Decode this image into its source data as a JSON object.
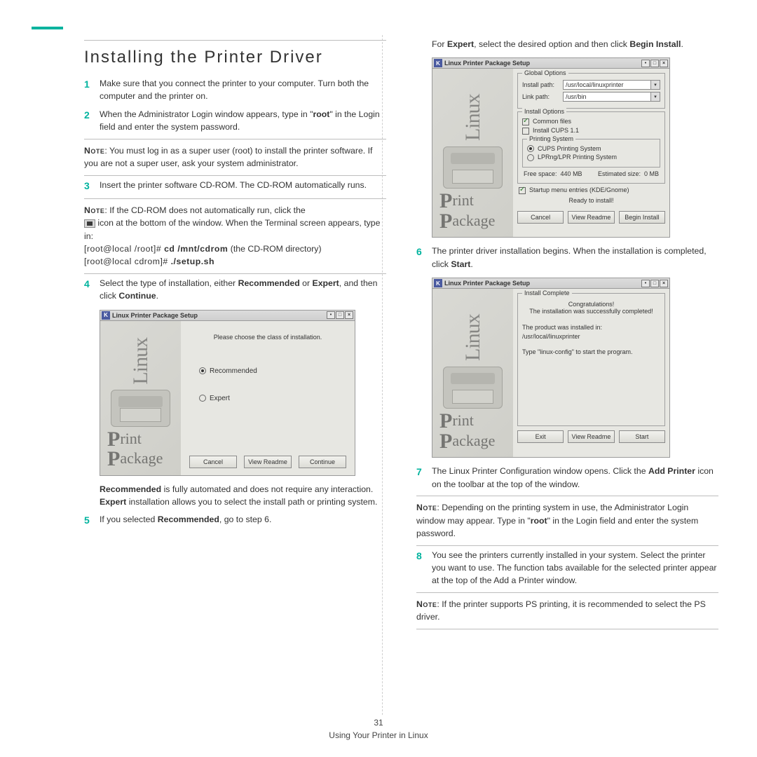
{
  "page": {
    "number": "31",
    "footer_text": "Using Your Printer in Linux"
  },
  "section_title": "Installing the Printer Driver",
  "left": {
    "steps": {
      "s1_num": "1",
      "s1": "Make sure that you connect the printer to your computer. Turn both the computer and the printer on.",
      "s2_num": "2",
      "s2_a": "When the Administrator Login window appears, type in \"",
      "s2_root": "root",
      "s2_b": "\" in the Login field and enter the system password.",
      "s3_num": "3",
      "s3": "Insert the printer software CD-ROM. The CD-ROM automatically runs.",
      "s4_num": "4",
      "s4_a": "Select the type of installation, either ",
      "s4_rec": "Recommended",
      "s4_b": " or ",
      "s4_exp": "Expert",
      "s4_c": ", and then click ",
      "s4_cont": "Continue",
      "s4_d": ".",
      "s5_num": "5",
      "s5_a": "If you selected ",
      "s5_rec": "Recommended",
      "s5_b": ", go to step 6."
    },
    "note1": {
      "label": "Note",
      "text": ": You must log in as a super user (root) to install the printer software. If you are not a super user, ask your system administrator."
    },
    "note2": {
      "label": "Note",
      "l1": ": If the CD-ROM does not automatically run, click the",
      "l2a": " icon at the bottom of the window. When the Terminal screen appears, type in:",
      "l3a": "[root@local /root]# ",
      "l3b": "cd /mnt/cdrom",
      "l3c": " (the CD-ROM directory)",
      "l4a": "[root@local cdrom]# ",
      "l4b": "./setup.sh"
    },
    "recpara": {
      "a": "Recommended",
      "b": " is fully automated and does not require any interaction. ",
      "c": "Expert",
      "d": " installation allows you to select the install path or printing system."
    }
  },
  "right": {
    "intro_a": "For ",
    "intro_exp": "Expert",
    "intro_b": ", select the desired option and then click ",
    "intro_begin": "Begin Install",
    "intro_c": ".",
    "steps": {
      "s6_num": "6",
      "s6_a": "The printer driver installation begins. When the installation is completed, click ",
      "s6_start": "Start",
      "s6_b": ".",
      "s7_num": "7",
      "s7_a": "The Linux Printer Configuration window opens. Click the ",
      "s7_add": "Add Printer",
      "s7_b": " icon on the toolbar at the top of the window.",
      "s8_num": "8",
      "s8": "You see the printers currently installed in your system. Select the printer you want to use. The function tabs available for the selected printer appear at the top of the Add a Printer window."
    },
    "note3": {
      "label": "Note",
      "a": ": Depending on the printing system in use, the Administrator Login window may appear. Type in \"",
      "root": "root",
      "b": "\" in the Login field and enter the system password."
    },
    "note4": {
      "label": "Note",
      "text": ": If the printer supports PS printing, it is recommended to select the PS driver."
    }
  },
  "shot_common": {
    "kicon": "K",
    "titlebar": "Linux Printer Package Setup",
    "linux": "Linux",
    "print": "rint",
    "package": "ackage",
    "view_readme": "View Readme"
  },
  "shot1": {
    "choose": "Please choose the class of installation.",
    "opt_rec": "Recommended",
    "opt_exp": "Expert",
    "cancel": "Cancel",
    "continue": "Continue"
  },
  "shot2": {
    "global": "Global Options",
    "install_path_l": "Install path:",
    "install_path_v": "/usr/local/linuxprinter",
    "link_path_l": "Link path:",
    "link_path_v": "/usr/bin",
    "install_opts": "Install Options",
    "common": "Common files",
    "cups11": "Install CUPS 1.1",
    "psys": "Printing System",
    "cups": "CUPS Printing System",
    "lprng": "LPRng/LPR Printing System",
    "free_l": "Free space:",
    "free_v": "440 MB",
    "est_l": "Estimated size:",
    "est_v": "0 MB",
    "startup": "Startup menu entries (KDE/Gnome)",
    "ready": "Ready to install!",
    "cancel": "Cancel",
    "begin": "Begin Install"
  },
  "shot3": {
    "legend": "Install Complete",
    "congrats": "Congratulations!",
    "success": "The installation was successfully completed!",
    "instin_a": "The product was installed in:",
    "instin_b": "/usr/local/linuxprinter",
    "howto": "Type \"linux-config\" to start the program.",
    "exit": "Exit",
    "start": "Start"
  }
}
